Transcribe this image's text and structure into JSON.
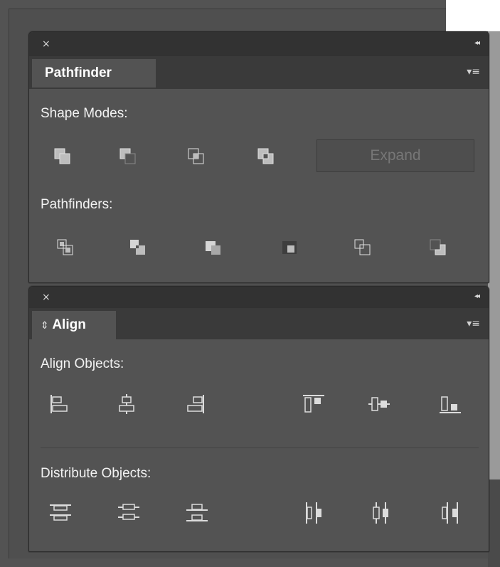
{
  "pathfinder_panel": {
    "close_glyph": "×",
    "collapse_glyph": "◂◂",
    "tab_label": "Pathfinder",
    "menu_glyph": "▾≡",
    "shape_modes_label": "Shape Modes:",
    "expand_label": "Expand",
    "pathfinders_label": "Pathfinders:"
  },
  "align_panel": {
    "close_glyph": "×",
    "collapse_glyph": "◂◂",
    "tab_label": "Align",
    "tab_prefix_glyph": "⇕",
    "menu_glyph": "▾≡",
    "align_objects_label": "Align Objects:",
    "distribute_objects_label": "Distribute Objects:"
  },
  "colors": {
    "panel_bg": "#535353",
    "titlebar_bg": "#323232",
    "text": "#f2f2f2",
    "icon_stroke": "#dcdcdc"
  }
}
